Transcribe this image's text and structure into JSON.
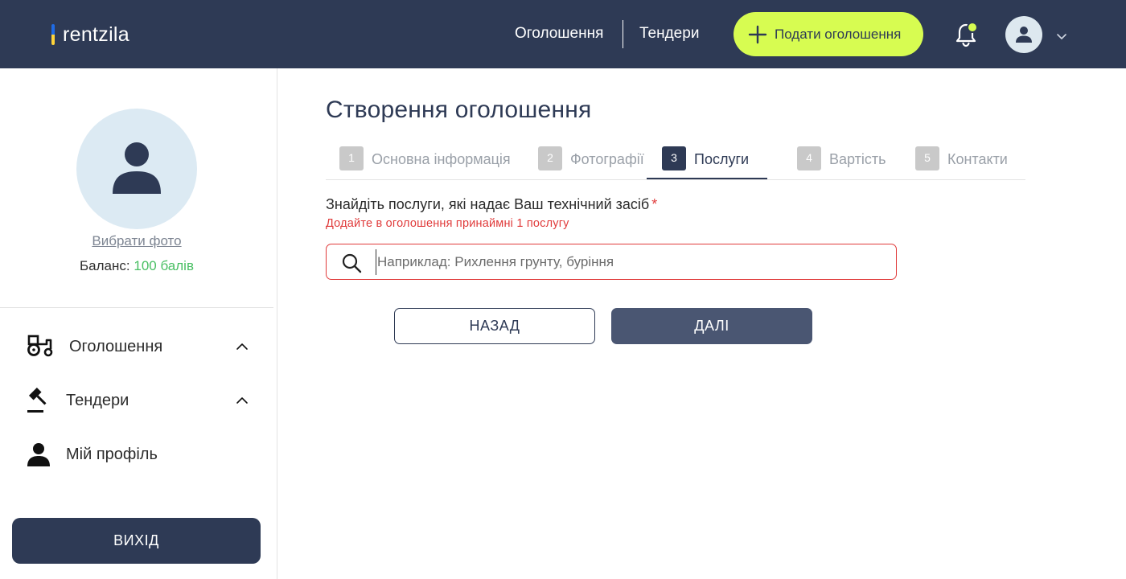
{
  "header": {
    "logo_text": "rentzila",
    "nav": {
      "ads": "Оголошення",
      "tenders": "Тендери"
    },
    "post_button": "Подати оголошення",
    "icons": {
      "notifications": "bell-icon",
      "avatar": "user-icon",
      "menu": "chevron-down-icon"
    }
  },
  "sidebar": {
    "choose_photo": "Вибрати фото",
    "balance_label": "Баланс:",
    "balance_value": "100 балів",
    "items": [
      {
        "label": "Оголошення",
        "icon": "tractor-icon"
      },
      {
        "label": "Тендери",
        "icon": "gavel-icon"
      },
      {
        "label": "Мій профіль",
        "icon": "user-icon"
      }
    ],
    "logout": "ВИХІД"
  },
  "main": {
    "title": "Створення оголошення",
    "steps": [
      {
        "num": "1",
        "label": "Основна інформація"
      },
      {
        "num": "2",
        "label": "Фотографії"
      },
      {
        "num": "3",
        "label": "Послуги"
      },
      {
        "num": "4",
        "label": "Вартість"
      },
      {
        "num": "5",
        "label": "Контакти"
      }
    ],
    "active_step": 3,
    "services": {
      "label": "Знайдіть послуги, які надає Ваш технічний засіб",
      "required_mark": "*",
      "error": "Додайте в оголошення принаймні 1 послугу",
      "search_placeholder": "Наприклад: Рихлення грунту, буріння",
      "search_value": ""
    },
    "back_button": "НАЗАД",
    "next_button": "ДАЛІ"
  },
  "colors": {
    "primary": "#2e3a55",
    "accent": "#d7fc51",
    "error": "#e03b3b",
    "balance": "#49bf63"
  }
}
